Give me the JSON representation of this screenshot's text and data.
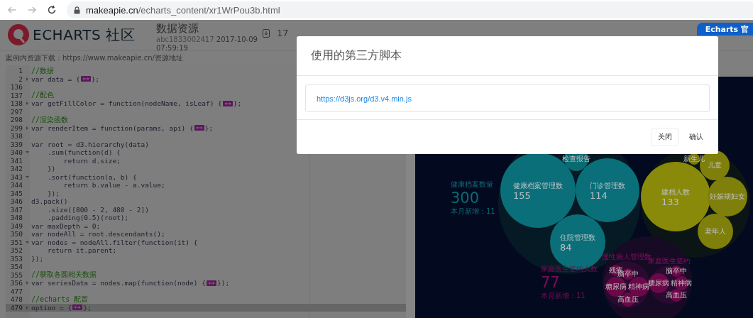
{
  "browser": {
    "url_host": "makeapie.cn",
    "url_path": "/echarts_content/xr1WrPou3b.html"
  },
  "header": {
    "logo_text": "ECHARTS 社区",
    "title": "数据资源",
    "author": "abc1833002417",
    "date": "2017-10-09",
    "time": "07:59:19",
    "downloads": "17",
    "official_button": "Echarts 官"
  },
  "resource_line": "案例内资源下载：https://www.makeapie.cn/资源地址",
  "editor": {
    "lines": [
      {
        "num": "1",
        "kind": "comment",
        "code": "//数据"
      },
      {
        "num": "2",
        "kind": "code",
        "collapsed": true,
        "code": "var data = {",
        "after": "};"
      },
      {
        "num": "136",
        "kind": "code"
      },
      {
        "num": "137",
        "kind": "comment",
        "code": "//配色"
      },
      {
        "num": "138",
        "kind": "code",
        "collapsed": true,
        "code": "var getFillColor = function(nodeName, isLeaf) {",
        "after": "};"
      },
      {
        "num": "297",
        "kind": "code"
      },
      {
        "num": "298",
        "kind": "comment",
        "code": "//渲染函数"
      },
      {
        "num": "299",
        "kind": "code",
        "collapsed": true,
        "code": "var renderItem = function(params, api) {",
        "after": "};"
      },
      {
        "num": "338",
        "kind": "code"
      },
      {
        "num": "339",
        "kind": "code",
        "code": "var root = d3.hierarchy(data)"
      },
      {
        "num": "340",
        "kind": "code",
        "collapsed": false,
        "code": "    .sum(function(d) {"
      },
      {
        "num": "341",
        "kind": "code",
        "code": "        return d.size;"
      },
      {
        "num": "342",
        "kind": "code",
        "code": "    })"
      },
      {
        "num": "343",
        "kind": "code",
        "collapsed": false,
        "code": "    .sort(function(a, b) {"
      },
      {
        "num": "344",
        "kind": "code",
        "code": "        return b.value - a.value;"
      },
      {
        "num": "345",
        "kind": "code",
        "code": "    });"
      },
      {
        "num": "346",
        "kind": "code",
        "code": "d3.pack()"
      },
      {
        "num": "347",
        "kind": "code",
        "code": "    .size([800 - 2, 480 - 2])"
      },
      {
        "num": "348",
        "kind": "code",
        "code": "    .padding(0.5)(root);"
      },
      {
        "num": "349",
        "kind": "code",
        "code": "var maxDepth = 0;"
      },
      {
        "num": "350",
        "kind": "code",
        "code": "var nodeAll = root.descendants();"
      },
      {
        "num": "351",
        "kind": "code",
        "collapsed": false,
        "code": "var nodes = nodeAll.filter(function(it) {"
      },
      {
        "num": "352",
        "kind": "code",
        "code": "    return it.parent;"
      },
      {
        "num": "353",
        "kind": "code",
        "code": "});"
      },
      {
        "num": "354",
        "kind": "code"
      },
      {
        "num": "355",
        "kind": "comment",
        "code": "//获取各圆相关数据"
      },
      {
        "num": "356",
        "kind": "code",
        "collapsed": true,
        "code": "var seriesData = nodes.map(function(node) {",
        "after": "});"
      },
      {
        "num": "477",
        "kind": "code"
      },
      {
        "num": "478",
        "kind": "comment",
        "code": "//echarts 配置"
      },
      {
        "num": "479",
        "kind": "code",
        "collapsed": true,
        "code": "option = {",
        "after": "};",
        "selected": true
      }
    ]
  },
  "chart": {
    "stats": [
      {
        "label": "健康档案数量",
        "value": "300",
        "note": "本月新增：11",
        "color": "#0c6a72"
      },
      {
        "label": "家庭医生签约人数",
        "value": "77",
        "note": "本月新增：11",
        "color": "#7a0c58"
      }
    ],
    "bubbles": [
      {
        "kind": "container",
        "color": "#061a26"
      },
      {
        "kind": "leaf",
        "label": "检查报告",
        "color": "#0a6a72"
      },
      {
        "kind": "leaf",
        "label": "健康档案管理数",
        "value": "155",
        "color": "#0a6f78"
      },
      {
        "kind": "leaf",
        "label": "门诊管理数",
        "value": "114",
        "color": "#0a6f78"
      },
      {
        "kind": "leaf",
        "label": "住院管理数",
        "value": "84",
        "color": "#0a6f78"
      },
      {
        "kind": "container",
        "color": "#0c1515"
      },
      {
        "kind": "leaf",
        "label": "新生儿",
        "color": "#7a7a0a"
      },
      {
        "kind": "leaf",
        "label": "儿童",
        "color": "#7f7f0c"
      },
      {
        "kind": "leaf",
        "label": "建档人数",
        "value": "133",
        "color": "#8a8a0a"
      },
      {
        "kind": "leaf",
        "label": "妊娠期妇女",
        "color": "#7f7f0c"
      },
      {
        "kind": "leaf",
        "label": "老年人",
        "color": "#7f7f0c"
      },
      {
        "kind": "container",
        "color": "#160a24"
      },
      {
        "kind": "group",
        "label": "慢性病人管理数",
        "color": "#2a0a30"
      },
      {
        "kind": "group",
        "label": "家庭医生签约",
        "color": "#2a0a30"
      },
      {
        "kind": "leaf",
        "label": "残疾",
        "color": "#6a0848"
      },
      {
        "kind": "leaf",
        "label": "脑卒中",
        "color": "#6a0848"
      },
      {
        "kind": "leaf",
        "label": "糖尿病",
        "color": "#6a0848"
      },
      {
        "kind": "leaf",
        "label": "精神病",
        "color": "#6a0848"
      },
      {
        "kind": "leaf",
        "label": "高血压",
        "color": "#6a0848"
      },
      {
        "kind": "leaf",
        "label": "脑卒中",
        "color": "#6a0848"
      },
      {
        "kind": "leaf",
        "label": "糖尿病",
        "color": "#6a0848"
      },
      {
        "kind": "leaf",
        "label": "精神病",
        "color": "#6a0848"
      },
      {
        "kind": "leaf",
        "label": "高血压",
        "color": "#6a0848"
      }
    ]
  },
  "modal": {
    "title": "使用的第三方脚本",
    "link": "https://d3js.org/d3.v4.min.js",
    "buttons": [
      {
        "label": "关闭",
        "kind": "outlined"
      },
      {
        "label": "确认",
        "kind": "plain"
      }
    ]
  }
}
